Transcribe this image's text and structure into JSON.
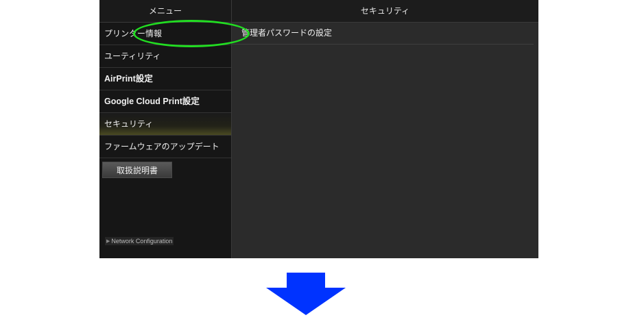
{
  "sidebar": {
    "header": "メニュー",
    "items": [
      {
        "label": "プリンター情報"
      },
      {
        "label": "ユーティリティ"
      },
      {
        "label": "AirPrint設定"
      },
      {
        "label": "Google Cloud Print設定"
      },
      {
        "label": "セキュリティ"
      },
      {
        "label": "ファームウェアのアップデート"
      }
    ],
    "manual_button": "取扱説明書",
    "network_configuration": "Network Configuration"
  },
  "content": {
    "header": "セキュリティ",
    "items": [
      {
        "label": "管理者パスワードの設定"
      }
    ]
  },
  "annotation": {
    "highlight_color": "#22dd22",
    "arrow_color": "#0033ff"
  }
}
